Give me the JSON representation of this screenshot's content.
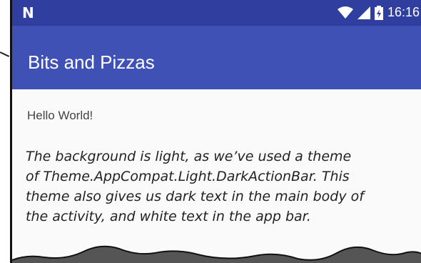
{
  "status_bar": {
    "carrier_glyph": "N",
    "time": "16:16",
    "icons": [
      "wifi-icon",
      "signal-icon",
      "battery-charging-icon"
    ]
  },
  "app_bar": {
    "title": "Bits and Pizzas"
  },
  "content": {
    "text_view": "Hello World!"
  },
  "annotation": {
    "lines": [
      "The background is light, as we’ve used a theme",
      "of Theme.AppCompat.Light.DarkActionBar. This",
      "theme also gives us dark text in the main body of",
      "the activity, and white text in the app bar."
    ]
  },
  "colors": {
    "status_bar": "#303f9f",
    "app_bar": "#3f51b5",
    "background": "#fafafa"
  }
}
